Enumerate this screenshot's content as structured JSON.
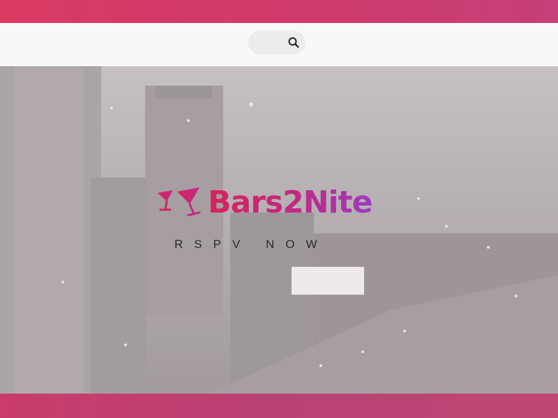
{
  "header": {
    "search": {
      "icon": "search-icon"
    }
  },
  "hero": {
    "brand": "Bars2Nite",
    "logo_icon": "cocktail-glasses-icon",
    "tagline": "RSPV  NOW",
    "background": "night city skyline"
  },
  "colors": {
    "top_bar": "#d93a62",
    "bottom_bar": "#c03f70",
    "brand_start": "#d6245a",
    "brand_end": "#9a3bc2"
  }
}
